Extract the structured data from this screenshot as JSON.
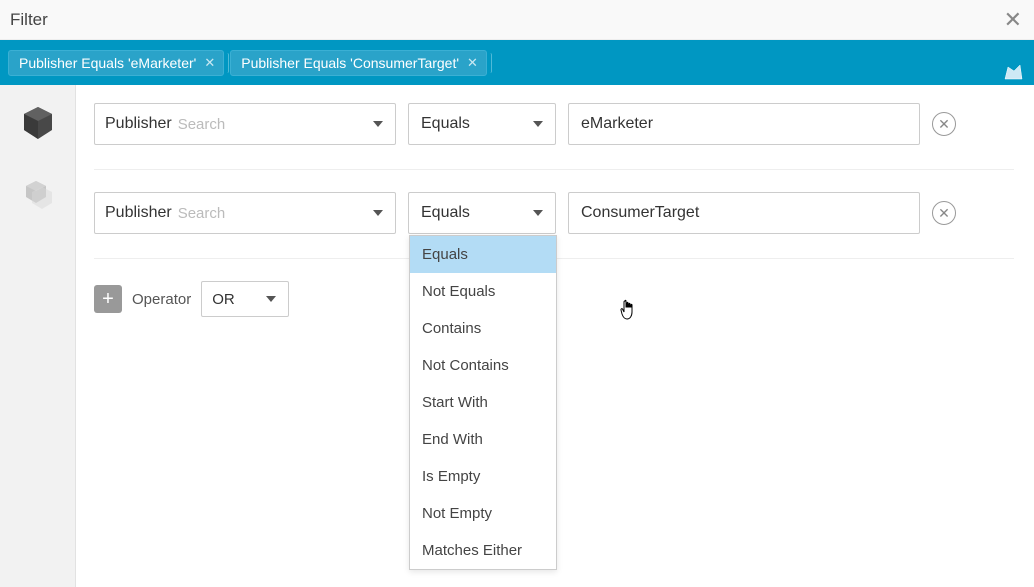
{
  "dialog": {
    "title": "Filter"
  },
  "chips": [
    {
      "label": "Publisher Equals 'eMarketer'"
    },
    {
      "label": "Publisher Equals 'ConsumerTarget'"
    }
  ],
  "rows": [
    {
      "field_label": "Publisher",
      "search_placeholder": "Search",
      "operator": "Equals",
      "value": "eMarketer"
    },
    {
      "field_label": "Publisher",
      "search_placeholder": "Search",
      "operator": "Equals",
      "value": "ConsumerTarget"
    }
  ],
  "add_operator": {
    "label": "Operator",
    "logic": "OR"
  },
  "operator_options": [
    "Equals",
    "Not Equals",
    "Contains",
    "Not Contains",
    "Start With",
    "End With",
    "Is Empty",
    "Not Empty",
    "Matches Either"
  ],
  "selected_operator_index": 0
}
